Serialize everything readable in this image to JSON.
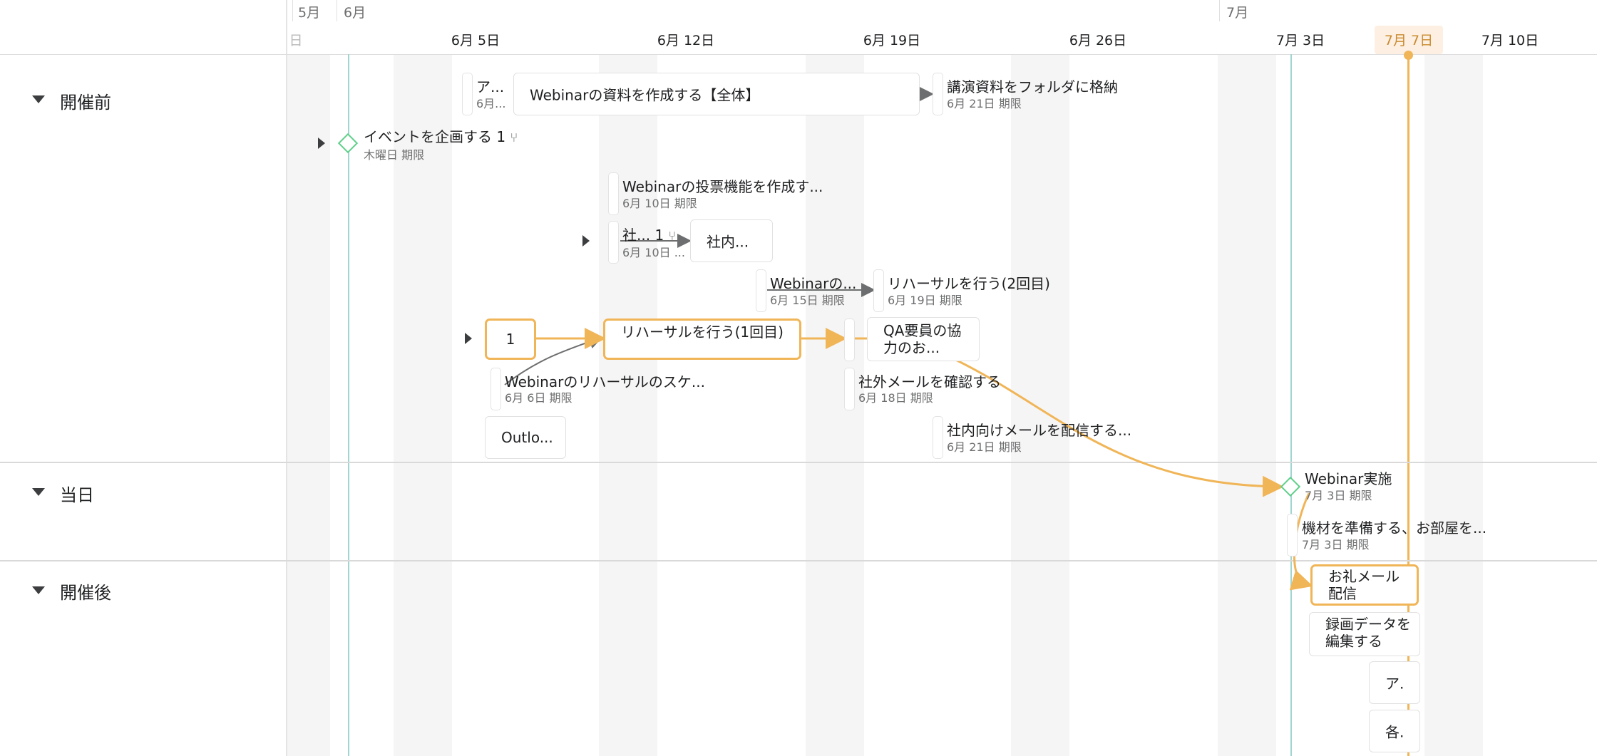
{
  "header": {
    "months": [
      "5月",
      "6月",
      "7月"
    ],
    "partial_day": "日",
    "days": [
      "6月 5日",
      "6月 12日",
      "6月 19日",
      "6月 26日",
      "7月 3日",
      "7月 7日",
      "7月 10日"
    ]
  },
  "sections": [
    {
      "title": "開催前",
      "collapsed": false
    },
    {
      "title": "当日",
      "collapsed": false
    },
    {
      "title": "開催後",
      "collapsed": false
    }
  ],
  "tasks": {
    "a_short": {
      "title": "ア...",
      "sub": "6月..."
    },
    "webinar_material": {
      "title": "Webinarの資料を作成する【全体】"
    },
    "lecture_folder": {
      "title": "講演資料をフォルダに格納",
      "sub": "6月 21日 期限"
    },
    "plan_event": {
      "title": "イベントを企画する",
      "subtasks": "1",
      "sub": "木曜日 期限"
    },
    "poll": {
      "title": "Webinarの投票機能を作成す...",
      "sub": "6月 10日 期限"
    },
    "internal_short": {
      "title": "社...",
      "subtasks": "1",
      "sub": "6月 10日 ..."
    },
    "internal_box": {
      "title": "社内..."
    },
    "webinar_short": {
      "title": "Webinarの...",
      "sub": "6月 15日 期限"
    },
    "rehearsal2": {
      "title": "リハーサルを行う(2回目)",
      "sub": "6月 19日 期限"
    },
    "one_box": {
      "title": "1"
    },
    "rehearsal1": {
      "title": "リハーサルを行う(1回目)"
    },
    "qa": {
      "title": "QA要員の協力のお..."
    },
    "rehearsal_schedule": {
      "title": "Webinarのリハーサルのスケ...",
      "sub": "6月 6日 期限"
    },
    "external_mail": {
      "title": "社外メールを確認する",
      "sub": "6月 18日 期限"
    },
    "internal_mail": {
      "title": "社内向けメールを配信する...",
      "sub": "6月 21日 期限"
    },
    "outlook": {
      "title": "Outlo..."
    },
    "webinar_run": {
      "title": "Webinar実施",
      "sub": "7月 3日 期限"
    },
    "equipment": {
      "title": "機材を準備する、お部屋を...",
      "sub": "7月 3日 期限"
    },
    "thanks_mail": {
      "title": "お礼メール配信"
    },
    "edit_recording": {
      "title": "録画データを編集する"
    },
    "a_box": {
      "title": "ア."
    },
    "each_box": {
      "title": "各."
    }
  },
  "colors": {
    "accent_orange": "#f0b557",
    "milestone_green": "#5fcf8a",
    "today_line": "#9fd6d0",
    "today_highlight": "#fdf0e3",
    "weekend_shade": "#f6f5f5"
  },
  "icons": [
    "caret-down-icon",
    "caret-right-icon",
    "milestone-diamond-icon",
    "subtask-icon",
    "dependency-arrow-icon"
  ]
}
